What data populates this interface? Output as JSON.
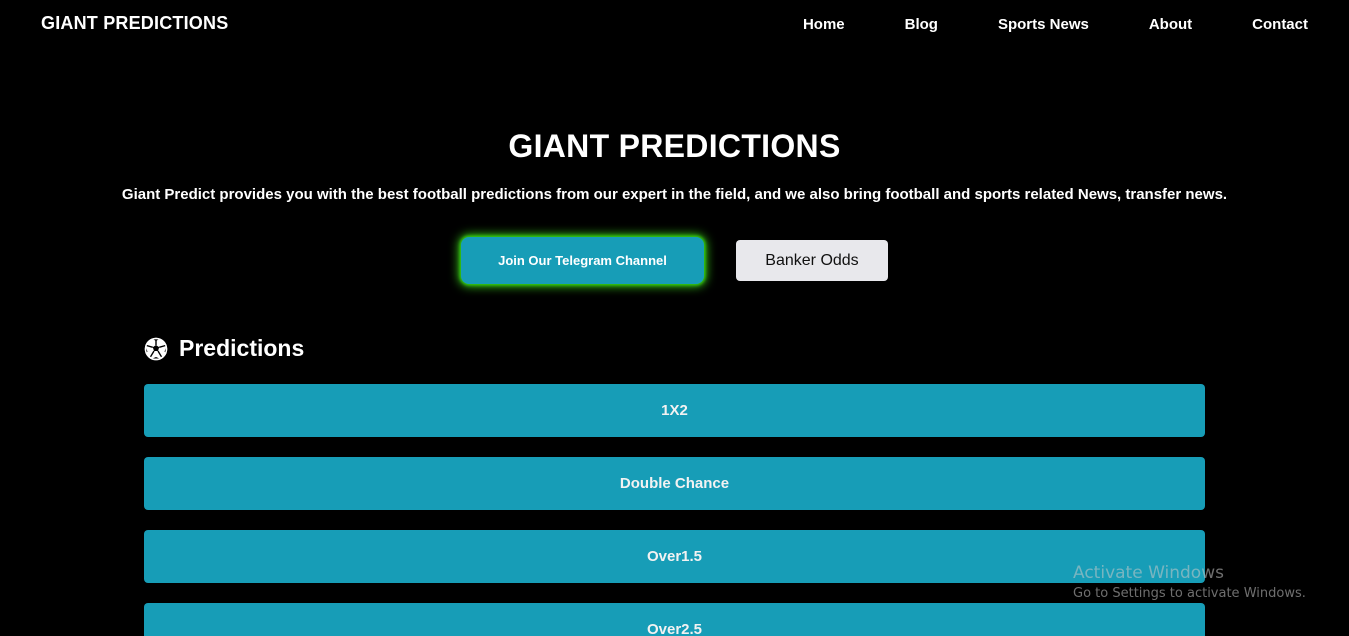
{
  "navbar": {
    "brand": "GIANT PREDICTIONS",
    "links": [
      "Home",
      "Blog",
      "Sports News",
      "About",
      "Contact"
    ]
  },
  "hero": {
    "title": "GIANT PREDICTIONS",
    "subtitle": "Giant Predict provides you with the best football predictions from our expert in the field, and we also bring football and sports related News, transfer news.",
    "telegram_button": "Join Our Telegram Channel",
    "banker_button": "Banker Odds"
  },
  "predictions": {
    "icon": "soccer-ball-icon",
    "heading": "Predictions",
    "items": [
      "1X2",
      "Double Chance",
      "Over1.5",
      "Over2.5"
    ]
  },
  "watermark": {
    "title": "Activate Windows",
    "subtitle": "Go to Settings to activate Windows."
  },
  "colors": {
    "background": "#000000",
    "accent": "#179db7",
    "glow": "#3bd11c",
    "banker_bg": "#e8e8ec"
  }
}
